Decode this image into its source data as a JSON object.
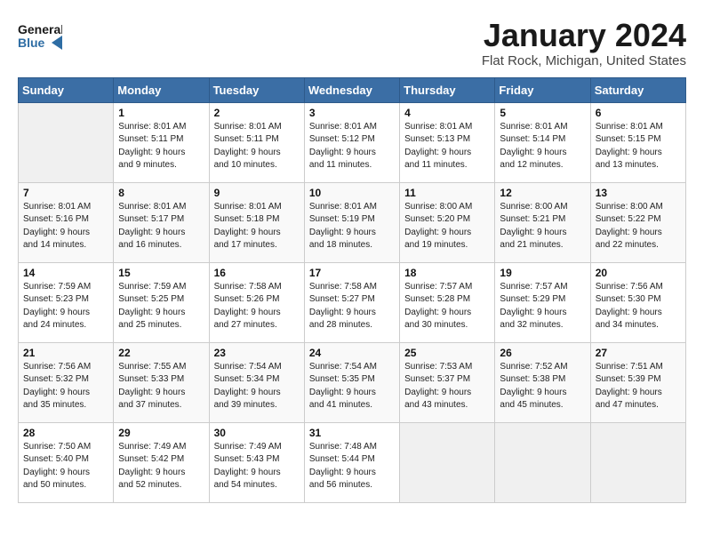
{
  "header": {
    "logo_general": "General",
    "logo_blue": "Blue",
    "month_title": "January 2024",
    "location": "Flat Rock, Michigan, United States"
  },
  "days_of_week": [
    "Sunday",
    "Monday",
    "Tuesday",
    "Wednesday",
    "Thursday",
    "Friday",
    "Saturday"
  ],
  "weeks": [
    [
      {
        "day": "",
        "info": ""
      },
      {
        "day": "1",
        "info": "Sunrise: 8:01 AM\nSunset: 5:11 PM\nDaylight: 9 hours\nand 9 minutes."
      },
      {
        "day": "2",
        "info": "Sunrise: 8:01 AM\nSunset: 5:11 PM\nDaylight: 9 hours\nand 10 minutes."
      },
      {
        "day": "3",
        "info": "Sunrise: 8:01 AM\nSunset: 5:12 PM\nDaylight: 9 hours\nand 11 minutes."
      },
      {
        "day": "4",
        "info": "Sunrise: 8:01 AM\nSunset: 5:13 PM\nDaylight: 9 hours\nand 11 minutes."
      },
      {
        "day": "5",
        "info": "Sunrise: 8:01 AM\nSunset: 5:14 PM\nDaylight: 9 hours\nand 12 minutes."
      },
      {
        "day": "6",
        "info": "Sunrise: 8:01 AM\nSunset: 5:15 PM\nDaylight: 9 hours\nand 13 minutes."
      }
    ],
    [
      {
        "day": "7",
        "info": "Sunrise: 8:01 AM\nSunset: 5:16 PM\nDaylight: 9 hours\nand 14 minutes."
      },
      {
        "day": "8",
        "info": "Sunrise: 8:01 AM\nSunset: 5:17 PM\nDaylight: 9 hours\nand 16 minutes."
      },
      {
        "day": "9",
        "info": "Sunrise: 8:01 AM\nSunset: 5:18 PM\nDaylight: 9 hours\nand 17 minutes."
      },
      {
        "day": "10",
        "info": "Sunrise: 8:01 AM\nSunset: 5:19 PM\nDaylight: 9 hours\nand 18 minutes."
      },
      {
        "day": "11",
        "info": "Sunrise: 8:00 AM\nSunset: 5:20 PM\nDaylight: 9 hours\nand 19 minutes."
      },
      {
        "day": "12",
        "info": "Sunrise: 8:00 AM\nSunset: 5:21 PM\nDaylight: 9 hours\nand 21 minutes."
      },
      {
        "day": "13",
        "info": "Sunrise: 8:00 AM\nSunset: 5:22 PM\nDaylight: 9 hours\nand 22 minutes."
      }
    ],
    [
      {
        "day": "14",
        "info": "Sunrise: 7:59 AM\nSunset: 5:23 PM\nDaylight: 9 hours\nand 24 minutes."
      },
      {
        "day": "15",
        "info": "Sunrise: 7:59 AM\nSunset: 5:25 PM\nDaylight: 9 hours\nand 25 minutes."
      },
      {
        "day": "16",
        "info": "Sunrise: 7:58 AM\nSunset: 5:26 PM\nDaylight: 9 hours\nand 27 minutes."
      },
      {
        "day": "17",
        "info": "Sunrise: 7:58 AM\nSunset: 5:27 PM\nDaylight: 9 hours\nand 28 minutes."
      },
      {
        "day": "18",
        "info": "Sunrise: 7:57 AM\nSunset: 5:28 PM\nDaylight: 9 hours\nand 30 minutes."
      },
      {
        "day": "19",
        "info": "Sunrise: 7:57 AM\nSunset: 5:29 PM\nDaylight: 9 hours\nand 32 minutes."
      },
      {
        "day": "20",
        "info": "Sunrise: 7:56 AM\nSunset: 5:30 PM\nDaylight: 9 hours\nand 34 minutes."
      }
    ],
    [
      {
        "day": "21",
        "info": "Sunrise: 7:56 AM\nSunset: 5:32 PM\nDaylight: 9 hours\nand 35 minutes."
      },
      {
        "day": "22",
        "info": "Sunrise: 7:55 AM\nSunset: 5:33 PM\nDaylight: 9 hours\nand 37 minutes."
      },
      {
        "day": "23",
        "info": "Sunrise: 7:54 AM\nSunset: 5:34 PM\nDaylight: 9 hours\nand 39 minutes."
      },
      {
        "day": "24",
        "info": "Sunrise: 7:54 AM\nSunset: 5:35 PM\nDaylight: 9 hours\nand 41 minutes."
      },
      {
        "day": "25",
        "info": "Sunrise: 7:53 AM\nSunset: 5:37 PM\nDaylight: 9 hours\nand 43 minutes."
      },
      {
        "day": "26",
        "info": "Sunrise: 7:52 AM\nSunset: 5:38 PM\nDaylight: 9 hours\nand 45 minutes."
      },
      {
        "day": "27",
        "info": "Sunrise: 7:51 AM\nSunset: 5:39 PM\nDaylight: 9 hours\nand 47 minutes."
      }
    ],
    [
      {
        "day": "28",
        "info": "Sunrise: 7:50 AM\nSunset: 5:40 PM\nDaylight: 9 hours\nand 50 minutes."
      },
      {
        "day": "29",
        "info": "Sunrise: 7:49 AM\nSunset: 5:42 PM\nDaylight: 9 hours\nand 52 minutes."
      },
      {
        "day": "30",
        "info": "Sunrise: 7:49 AM\nSunset: 5:43 PM\nDaylight: 9 hours\nand 54 minutes."
      },
      {
        "day": "31",
        "info": "Sunrise: 7:48 AM\nSunset: 5:44 PM\nDaylight: 9 hours\nand 56 minutes."
      },
      {
        "day": "",
        "info": ""
      },
      {
        "day": "",
        "info": ""
      },
      {
        "day": "",
        "info": ""
      }
    ]
  ]
}
